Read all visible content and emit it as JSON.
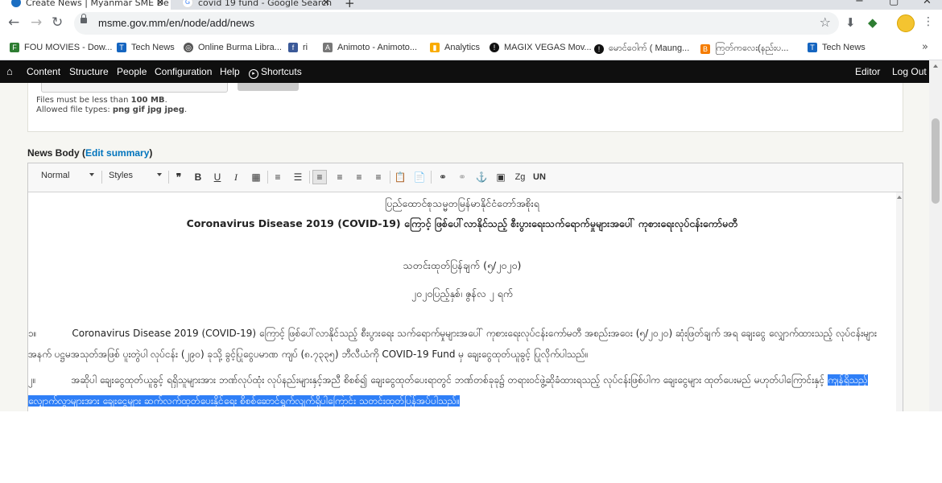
{
  "browser": {
    "tabs": [
      {
        "title": "Create News | Myanmar SME De",
        "active": true
      },
      {
        "title": "covid 19 fund - Google Search",
        "active": false
      }
    ],
    "url": "msme.gov.mm/en/node/add/news",
    "colors": {
      "tab_bg": "#dee1e6",
      "omnibox": "#f1f3f4"
    }
  },
  "bookmarks": [
    {
      "label": "FOU MOVIES - Dow...",
      "icon": "fm-icon",
      "color": "#2e7d32"
    },
    {
      "label": "Tech News",
      "icon": "tech-news-icon",
      "color": "#1565c0"
    },
    {
      "label": "Online Burma Libra...",
      "icon": "globe-icon",
      "color": "#555555"
    },
    {
      "label": "ri",
      "icon": "facebook-icon",
      "color": "#3b5998"
    },
    {
      "label": "Animoto - Animoto...",
      "icon": "animoto-icon",
      "color": "#555555"
    },
    {
      "label": "Analytics",
      "icon": "analytics-icon",
      "color": "#f9ab00"
    },
    {
      "label": "MAGIX VEGAS Mov...",
      "icon": "magix-icon",
      "color": "#111111"
    },
    {
      "label": "မောင်ဝေါက် ( Maung...",
      "icon": "maung-icon",
      "color": "#111111"
    },
    {
      "label": "ကြတ်ကလေး(နည်းပ...",
      "icon": "blogger-icon",
      "color": "#f57c00"
    },
    {
      "label": "Tech News",
      "icon": "tech-news-icon",
      "color": "#1565c0"
    }
  ],
  "admin_menu": {
    "items": [
      "Content",
      "Structure",
      "People",
      "Configuration",
      "Help"
    ],
    "shortcuts": "Shortcuts",
    "editor": "Editor",
    "logout": "Log Out"
  },
  "file_field": {
    "help_size_prefix": "Files must be less than ",
    "help_size_value": "100 MB",
    "help_size_suffix": ".",
    "help_types_prefix": "Allowed file types: ",
    "help_types_value": "png gif jpg jpeg",
    "help_types_suffix": "."
  },
  "news_body": {
    "label": "News Body (",
    "edit_summary": "Edit summary",
    "label_end": ")"
  },
  "ckeditor": {
    "format": "Normal",
    "styles": "Styles"
  },
  "document": {
    "heading1": "ပြည်ထောင်စုသမ္မတမြန်မာနိုင်ငံတော်အစိုးရ",
    "heading2": "Coronavirus Disease 2019 (COVID-19) ကြောင့် ဖြစ်ပေါ်လာနိုင်သည့် စီးပွားရေးသက်ရောက်မှုများအပေါ် ကုစားရေးလုပ်ငန်းကော်မတီ",
    "release": "သတင်းထုတ်ပြန်ချက် (၅/၂၀၂၀)",
    "date": "၂၀၂၀ပြည့်နှစ်၊ ဇွန်လ ၂ ရက်",
    "para1_num": "၁။",
    "para1": "Coronavirus Disease 2019 (COVID-19) ကြောင့် ဖြစ်ပေါ်လာနိုင်သည့် စီးပွားရေး သက်ရောက်မှုများအပေါ် ကုစားရေးလုပ်ငန်းကော်မတီ အစည်းအဝေး (၅/၂၀၂၀) ဆုံးဖြတ်ချက် အရ ချေးငွေ လျှောက်ထားသည့် လုပ်ငန်းများအနက် ပဋ္ဌမအသုတ်အဖြစ် ပူးတွဲပါ လုပ်ငန်း (၂၉၀) ခုသို့ ခွင့်ပြုငွေပမာဏ ကျပ် (၈.၇၃၃၅) ဘီလီယံကို COVID-19 Fund မှ ချေးငွေထုတ်ယူခွင့် ပြုလိုက်ပါသည်။",
    "para2_num": "၂။",
    "para2": "အဆိုပါ ချေးငွေထုတ်ယူခွင့် ရရှိသူများအား ဘဏ်လုပ်ထုံး လုပ်နည်းများနှင့်အညီ စိစစ်၍ ချေးငွေထုတ်ပေးရာတွင် ဘဏ်တစ်ခုခု၌ တရားဝင်ဖွဲ့ဆိုခံထားရသည့် လုပ်ငန်းဖြစ်ပါက ချေးငွေများ ထုတ်ပေးမည် မဟုတ်ပါကြောင်းနှင့် ",
    "para2_selected": "ကျန်ရှိသည့် လျှောက်လွှာများအား ချေးငွေများ ဆက်လက်ထုတ်ပေးနိုင်ရေး စိစစ်ဆောင်ရွက်လျက်ရှိပါကြောင်း သတင်းထုတ်ပြန်အပ်ပါသည်။"
  }
}
